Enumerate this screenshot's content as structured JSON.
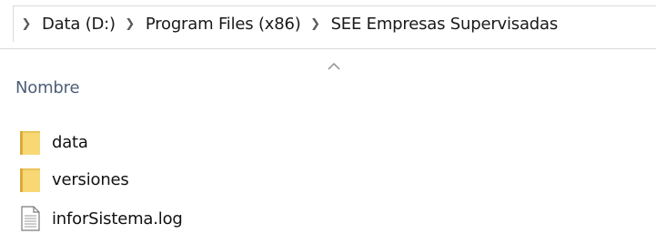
{
  "breadcrumb": {
    "items": [
      {
        "label": "Data (D:)"
      },
      {
        "label": "Program Files (x86)"
      },
      {
        "label": "SEE Empresas Supervisadas"
      }
    ]
  },
  "columns": {
    "name_header": "Nombre",
    "sort_direction": "ascending"
  },
  "files": [
    {
      "name": "data",
      "type": "folder",
      "icon": "folder-icon"
    },
    {
      "name": "versiones",
      "type": "folder",
      "icon": "folder-icon"
    },
    {
      "name": "inforSistema.log",
      "type": "file",
      "icon": "text-file-icon"
    }
  ],
  "colors": {
    "folder_yellow": "#f8d775",
    "folder_dark": "#e0b84a",
    "header_text": "#4c607a"
  }
}
